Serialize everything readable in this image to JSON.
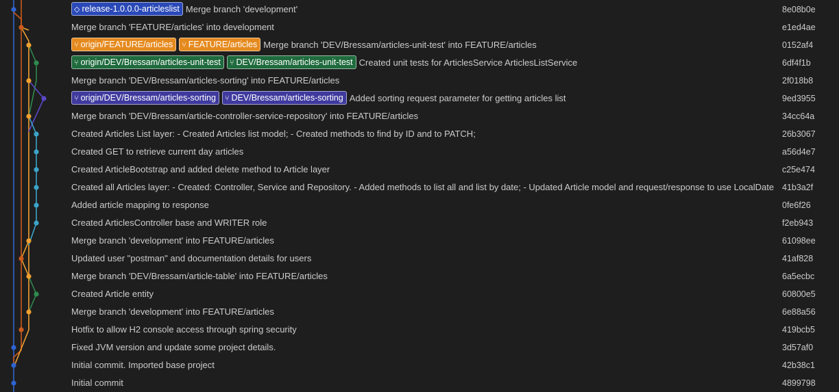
{
  "colors": {
    "blue": "#2f64d1",
    "red_orange": "#cc5b1c",
    "orange": "#f0a030",
    "green": "#2f8a4f",
    "purple": "#5a47c7",
    "cyan": "#3ba4c9"
  },
  "commits": [
    {
      "badges": [
        {
          "text": "release-1.0.0.0-articleslist",
          "kind": "tag",
          "icon": "tag-icon"
        }
      ],
      "message": "Merge branch 'development'",
      "hash": "8e08b0e"
    },
    {
      "badges": [],
      "message": "Merge branch 'FEATURE/articles' into development",
      "hash": "e1ed4ae"
    },
    {
      "badges": [
        {
          "text": "origin/FEATURE/articles",
          "kind": "orange",
          "icon": "branch-icon"
        },
        {
          "text": "FEATURE/articles",
          "kind": "orange",
          "icon": "branch-icon"
        }
      ],
      "message": "Merge branch 'DEV/Bressam/articles-unit-test' into FEATURE/articles",
      "hash": "0152af4"
    },
    {
      "badges": [
        {
          "text": "origin/DEV/Bressam/articles-unit-test",
          "kind": "green",
          "icon": "branch-icon"
        },
        {
          "text": "DEV/Bressam/articles-unit-test",
          "kind": "green",
          "icon": "branch-icon"
        }
      ],
      "message": "Created unit tests for ArticlesService ArticlesListService",
      "hash": "6df4f1b"
    },
    {
      "badges": [],
      "message": "Merge branch 'DEV/Bressam/articles-sorting' into FEATURE/articles",
      "hash": "2f018b8"
    },
    {
      "badges": [
        {
          "text": "origin/DEV/Bressam/articles-sorting",
          "kind": "purple",
          "icon": "branch-icon"
        },
        {
          "text": "DEV/Bressam/articles-sorting",
          "kind": "purple",
          "icon": "branch-icon"
        }
      ],
      "message": "Added sorting request parameter for getting articles list",
      "hash": "9ed3955"
    },
    {
      "badges": [],
      "message": "Merge branch 'DEV/Bressam/article-controller-service-repository' into FEATURE/articles",
      "hash": "34cc64a"
    },
    {
      "badges": [],
      "message": "Created Articles List layer:  - Created Articles list model;  - Created methods to find by ID and to PATCH;",
      "hash": "26b3067"
    },
    {
      "badges": [],
      "message": "Created GET to retrieve current day articles",
      "hash": "a56d4e7"
    },
    {
      "badges": [],
      "message": "Created ArticleBootstrap and added delete method to Article layer",
      "hash": "c25e474"
    },
    {
      "badges": [],
      "message": "Created all Articles layer:  - Created: Controller, Service and Repository.  - Added methods to list all and list by date;  - Updated Article model and request/response to use LocalDate;",
      "hash": "41b3a2f"
    },
    {
      "badges": [],
      "message": "Added article mapping to response",
      "hash": "0fe6f26"
    },
    {
      "badges": [],
      "message": "Created ArticlesController base and WRITER role",
      "hash": "f2eb943"
    },
    {
      "badges": [],
      "message": "Merge branch 'development' into FEATURE/articles",
      "hash": "61098ee"
    },
    {
      "badges": [],
      "message": "Updated user \"postman\" and documentation details for users",
      "hash": "41af828"
    },
    {
      "badges": [],
      "message": "Merge branch 'DEV/Bressam/article-table' into FEATURE/articles",
      "hash": "6a5ecbc"
    },
    {
      "badges": [],
      "message": "Created Article entity",
      "hash": "60800e5"
    },
    {
      "badges": [],
      "message": "Merge branch 'development' into FEATURE/articles",
      "hash": "6e88a56"
    },
    {
      "badges": [],
      "message": "Hotfix to allow H2 console access through spring security",
      "hash": "419bcb5"
    },
    {
      "badges": [],
      "message": "Fixed JVM version and update some project details.",
      "hash": "3d57af0"
    },
    {
      "badges": [],
      "message": "Initial commit. Imported base project",
      "hash": "42b38c1"
    },
    {
      "badges": [],
      "message": "Initial commit",
      "hash": "4899798"
    }
  ]
}
